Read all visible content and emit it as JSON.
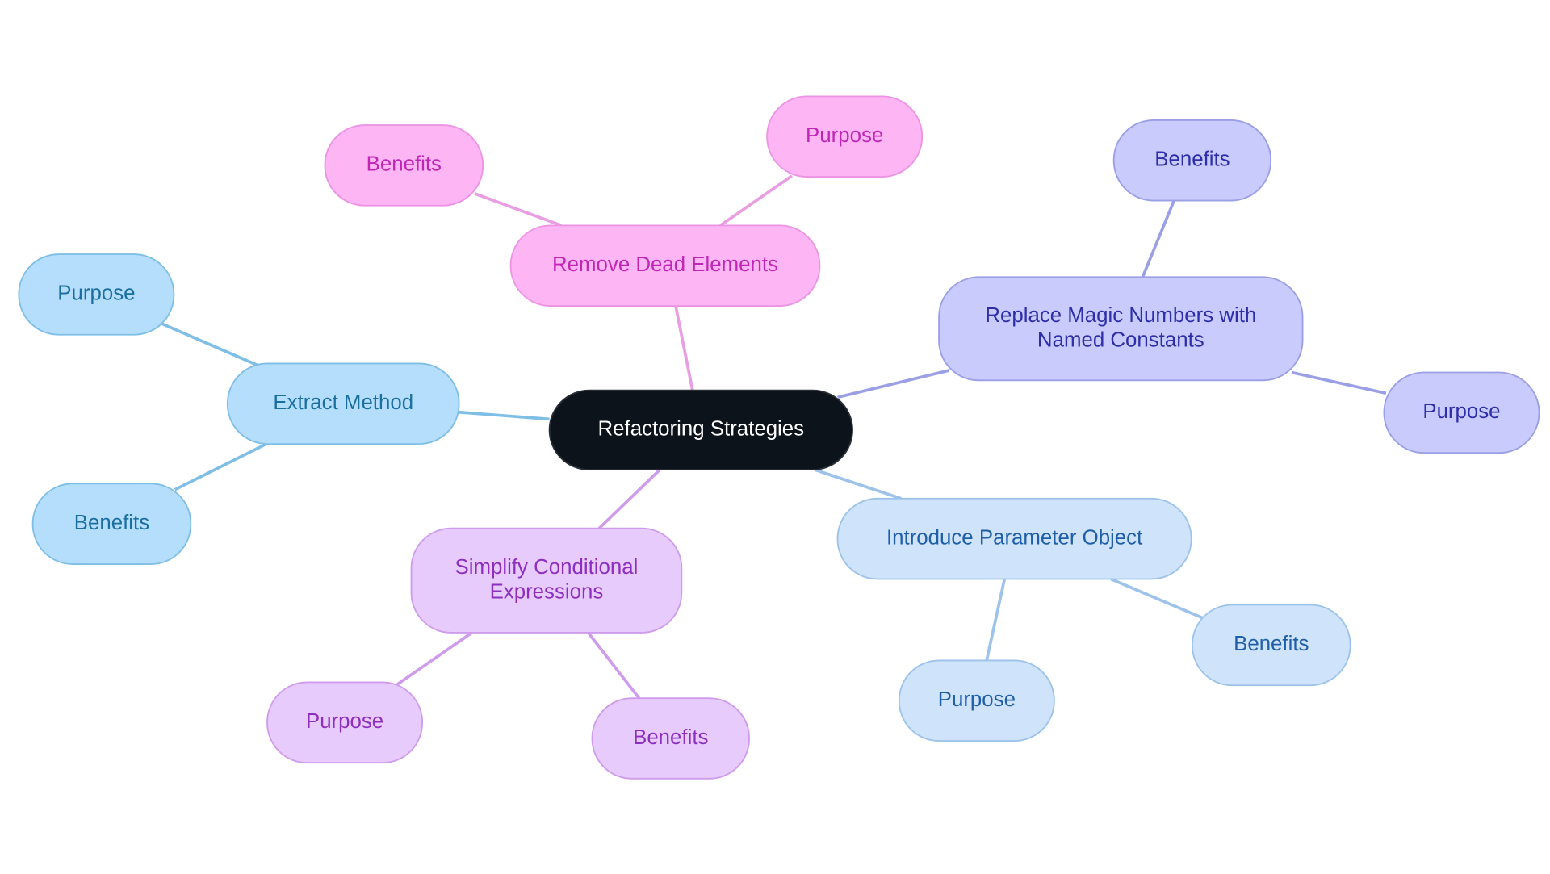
{
  "title": "Refactoring Strategies",
  "root": {
    "label": "Refactoring Strategies",
    "fill": "#0d131a",
    "text": "#ffffff"
  },
  "branches": [
    {
      "label": "Remove Dead Elements",
      "fill": "#fdb5f3",
      "stroke": "#ec93e4",
      "text": "#c026b5",
      "line": "#e99de2",
      "children": [
        {
          "label": "Benefits"
        },
        {
          "label": "Purpose"
        }
      ]
    },
    {
      "label": "Replace Magic Numbers with\nNamed Constants",
      "fill": "#c8cbfc",
      "stroke": "#9a9fe6",
      "text": "#2e2fa8",
      "line": "#9a9fe6",
      "children": [
        {
          "label": "Benefits"
        },
        {
          "label": "Purpose"
        }
      ]
    },
    {
      "label": "Introduce Parameter Object",
      "fill": "#cfe3fb",
      "stroke": "#9dc3ea",
      "text": "#1f5fa8",
      "line": "#9dc3ea",
      "children": [
        {
          "label": "Purpose"
        },
        {
          "label": "Benefits"
        }
      ]
    },
    {
      "label": "Simplify Conditional\nExpressions",
      "fill": "#e8cbfd",
      "stroke": "#cf9cec",
      "text": "#8c2fc0",
      "line": "#cf9cec",
      "children": [
        {
          "label": "Purpose"
        },
        {
          "label": "Benefits"
        }
      ]
    },
    {
      "label": "Extract Method",
      "fill": "#b4defc",
      "stroke": "#7fbfe6",
      "text": "#1a6fa0",
      "line": "#7fbfe6",
      "children": [
        {
          "label": "Purpose"
        },
        {
          "label": "Benefits"
        }
      ]
    }
  ]
}
